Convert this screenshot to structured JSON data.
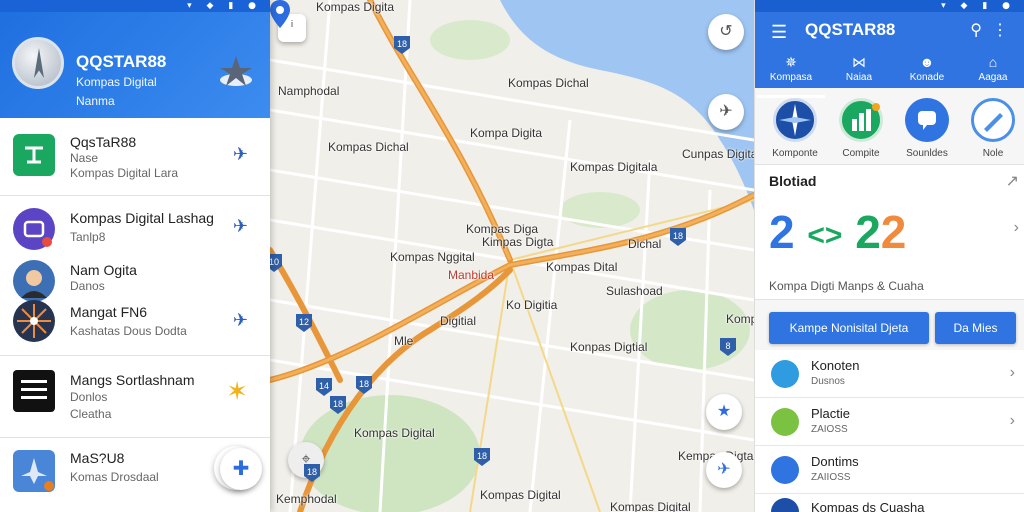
{
  "left_panel": {
    "app_title": "QQSTAR88",
    "app_subtitle": "Kompas Digital",
    "app_subtitle2": "Nanma",
    "items": [
      {
        "title": "QqsTaR88",
        "line2": "Nase",
        "line3": "Kompas Digital Lara",
        "icon": "grid-icon",
        "icon_color": "#1aa860"
      },
      {
        "title": "Kompas Digital Lashag",
        "line2": "Tanlp8",
        "icon": "compass-icon",
        "icon_color": "#5b45c5"
      },
      {
        "title": "Nam Ogita",
        "line2": "Danos",
        "icon": "avatar-icon",
        "icon_color": "#3d6fb5"
      },
      {
        "title": "Mangat FN6",
        "line2": "Kashatas Dous Dodta",
        "icon": "burst-icon",
        "icon_color": "#26344f"
      },
      {
        "title": "Mangs Sortlashnam",
        "line2": "Donlos",
        "line3": "Cleatha",
        "icon": "text-tile-icon",
        "icon_color": "#111111"
      },
      {
        "title": "MaS?U8",
        "line2": "Komas Drosdaal",
        "icon": "plane-icon",
        "icon_color": "#4a86d8"
      }
    ]
  },
  "map": {
    "labels": [
      {
        "text": "Kompas Digita",
        "cls": ""
      },
      {
        "text": "Namphodal",
        "cls": ""
      },
      {
        "text": "Kompas Dichal",
        "cls": ""
      },
      {
        "text": "Kompa Digita",
        "cls": ""
      },
      {
        "text": "Cunpas Digita",
        "cls": ""
      },
      {
        "text": "Kompas Diga",
        "cls": ""
      },
      {
        "text": "Kimpas Digta",
        "cls": "red"
      },
      {
        "text": "Manbida",
        "cls": ""
      },
      {
        "text": "Kompas Dital",
        "cls": ""
      },
      {
        "text": "Dichal",
        "cls": ""
      },
      {
        "text": "Digitial",
        "cls": ""
      },
      {
        "text": "Ko Digitia",
        "cls": ""
      },
      {
        "text": "Mle",
        "cls": ""
      },
      {
        "text": "Kompas Digit",
        "cls": ""
      },
      {
        "text": "Sulashoad",
        "cls": ""
      },
      {
        "text": "Kompas Digital",
        "cls": ""
      },
      {
        "text": "Kempas Digta",
        "cls": ""
      },
      {
        "text": "Kemphodal",
        "cls": ""
      },
      {
        "text": "Kompas Digital",
        "cls": ""
      },
      {
        "text": "Kompas Digital",
        "cls": ""
      },
      {
        "text": "Kompas Dichal",
        "cls": ""
      },
      {
        "text": "Kompas Digitala",
        "cls": ""
      },
      {
        "text": "Kompas Nggital",
        "cls": ""
      },
      {
        "text": "Konpas Digtial",
        "cls": ""
      }
    ],
    "shields": [
      "18",
      "18",
      "12",
      "14",
      "18",
      "18",
      "18",
      "18",
      "10",
      "8"
    ]
  },
  "right_panel": {
    "title": "QQSTAR88",
    "tabs": [
      {
        "icon": "compass-icon",
        "label": "Kompasa"
      },
      {
        "icon": "map-icon",
        "label": "Naiaa"
      },
      {
        "icon": "people-icon",
        "label": "Konade"
      },
      {
        "icon": "home-icon",
        "label": "Aagaa"
      }
    ],
    "shortcuts": [
      {
        "label": "Komponte",
        "color": "#1d4fa8"
      },
      {
        "label": "Compite",
        "color": "#1aa860"
      },
      {
        "label": "Sounldes",
        "color": "#2f74e0"
      },
      {
        "label": "Nole",
        "color": "#4a8fe8"
      }
    ],
    "card": {
      "title": "Blotiad",
      "big_text": "2 <> 22",
      "caption": "Kompa Digti Manps & Cuaha"
    },
    "primary_button": "Kampe Nonisital Djeta",
    "secondary_button": "Da Mies",
    "list": [
      {
        "title": "Konoten",
        "sub": "Dusnos",
        "color": "#2f9be0"
      },
      {
        "title": "Plactie",
        "sub": "ZAIOSS",
        "color": "#7cc242"
      },
      {
        "title": "Dontims",
        "sub": "ZAIIOSS",
        "color": "#2f74e0"
      },
      {
        "title": "Kompas ds Cuasha",
        "sub": "",
        "color": "#1d4fa8"
      }
    ]
  }
}
